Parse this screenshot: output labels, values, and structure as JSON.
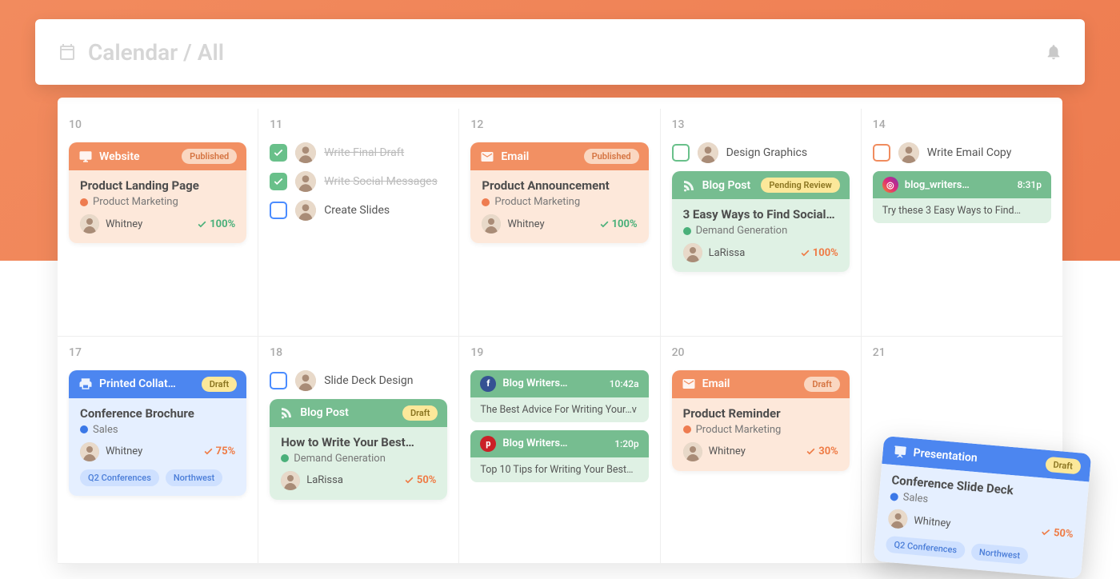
{
  "header": {
    "title": "Calendar / All"
  },
  "weeks": [
    {
      "days": [
        {
          "num": "10",
          "cards": [
            {
              "kind": "project",
              "color": "orange",
              "type_icon": "monitor",
              "type_label": "Website",
              "status": "Published",
              "title": "Product Landing Page",
              "category": "Product Marketing",
              "cat_color": "#ee7c50",
              "assignee": "Whitney",
              "pct": "100%",
              "pct_color": "green"
            }
          ]
        },
        {
          "num": "11",
          "tasks": [
            {
              "label": "Write Final Draft",
              "done": true,
              "box": "green-filled"
            },
            {
              "label": "Write Social Messages",
              "done": true,
              "box": "green-filled"
            },
            {
              "label": "Create Slides",
              "done": false,
              "box": "blue-empty"
            }
          ]
        },
        {
          "num": "12",
          "cards": [
            {
              "kind": "project",
              "color": "orange",
              "type_icon": "mail",
              "type_label": "Email",
              "status": "Published",
              "title": "Product Announcement",
              "category": "Product Marketing",
              "cat_color": "#ee7c50",
              "assignee": "Whitney",
              "pct": "100%",
              "pct_color": "green"
            }
          ]
        },
        {
          "num": "13",
          "tasks": [
            {
              "label": "Design Graphics",
              "done": false,
              "box": "green-empty"
            }
          ],
          "cards": [
            {
              "kind": "project",
              "color": "green",
              "type_icon": "rss",
              "type_label": "Blog Post",
              "status": "Pending Review",
              "title": "3 Easy Ways to Find Social…",
              "category": "Demand Generation",
              "cat_color": "#4ab07a",
              "assignee": "LaRissa",
              "pct": "100%",
              "pct_color": "orange"
            }
          ]
        },
        {
          "num": "14",
          "tasks": [
            {
              "label": "Write Email Copy",
              "done": false,
              "box": "orange-empty"
            }
          ],
          "minis": [
            {
              "color": "green",
              "net": "ig",
              "net_glyph": "◎",
              "handle": "blog_writers…",
              "time": "8:31p",
              "text": "Try these 3 Easy Ways to Find…"
            }
          ]
        }
      ]
    },
    {
      "days": [
        {
          "num": "17",
          "cards": [
            {
              "kind": "project",
              "color": "blue",
              "type_icon": "print",
              "type_label": "Printed Collat…",
              "status": "Draft",
              "title": "Conference Brochure",
              "category": "Sales",
              "cat_color": "#3b78e7",
              "assignee": "Whitney",
              "pct": "75%",
              "pct_color": "orange",
              "tags": [
                "Q2 Conferences",
                "Northwest"
              ]
            }
          ]
        },
        {
          "num": "18",
          "tasks": [
            {
              "label": "Slide Deck Design",
              "done": false,
              "box": "blue-empty"
            }
          ],
          "cards": [
            {
              "kind": "project",
              "color": "green",
              "type_icon": "rss",
              "type_label": "Blog Post",
              "status": "Draft",
              "title": "How to Write Your Best…",
              "category": "Demand Generation",
              "cat_color": "#4ab07a",
              "assignee": "LaRissa",
              "pct": "50%",
              "pct_color": "orange"
            }
          ]
        },
        {
          "num": "19",
          "minis": [
            {
              "color": "green",
              "net": "fb",
              "net_glyph": "f",
              "handle": "Blog Writers…",
              "time": "10:42a",
              "text": "The Best Advice For Writing Your…v"
            },
            {
              "color": "green",
              "net": "pn",
              "net_glyph": "p",
              "handle": "Blog Writers…",
              "time": "1:20p",
              "text": "Top 10 Tips for Writing Your Best…"
            }
          ]
        },
        {
          "num": "20",
          "cards": [
            {
              "kind": "project",
              "color": "orange",
              "type_icon": "mail",
              "type_label": "Email",
              "status": "Draft",
              "title": "Product Reminder",
              "category": "Product Marketing",
              "cat_color": "#ee7c50",
              "assignee": "Whitney",
              "pct": "30%",
              "pct_color": "orange"
            }
          ]
        },
        {
          "num": "21"
        }
      ]
    }
  ],
  "floating_card": {
    "color": "blue",
    "type_icon": "presentation",
    "type_label": "Presentation",
    "status": "Draft",
    "title": "Conference Slide Deck",
    "category": "Sales",
    "cat_color": "#3b78e7",
    "assignee": "Whitney",
    "pct": "50%",
    "pct_color": "orange",
    "tags": [
      "Q2 Conferences",
      "Northwest"
    ]
  }
}
